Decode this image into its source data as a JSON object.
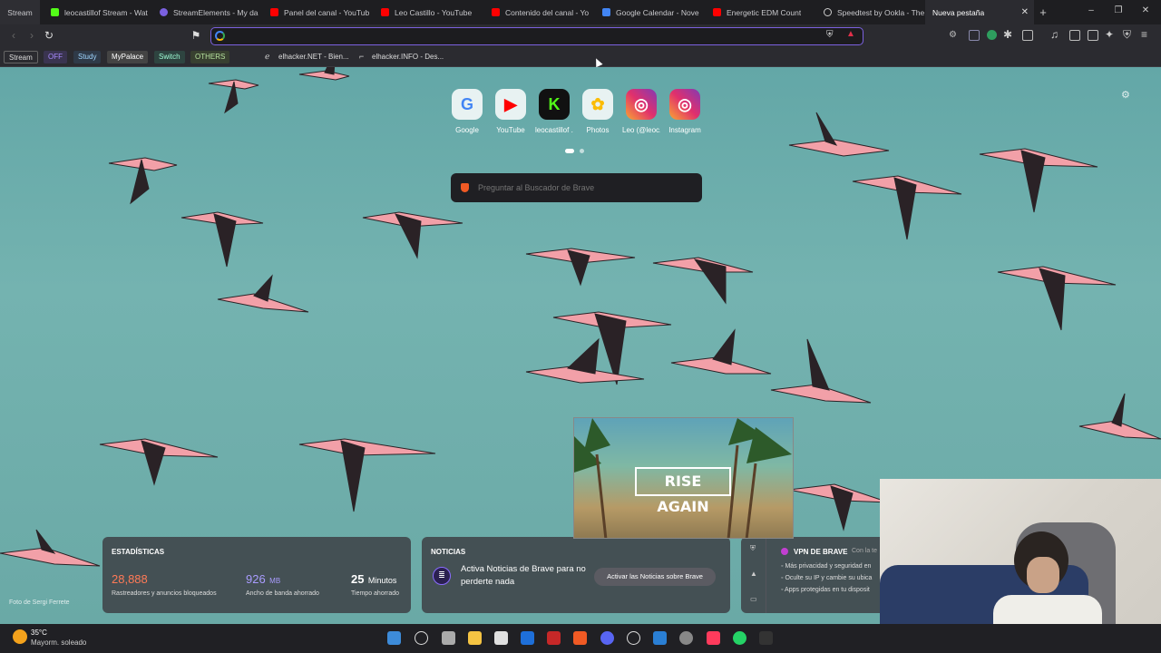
{
  "tabs": [
    {
      "title": "Stream",
      "color": "#2e2e33"
    },
    {
      "title": "leocastillof Stream - Wat",
      "color": "#53fc18"
    },
    {
      "title": "StreamElements - My da",
      "color": "#7b61e0"
    },
    {
      "title": "Panel del canal - YouTub",
      "color": "#ff0000"
    },
    {
      "title": "Leo Castillo - YouTube",
      "color": "#ff0000"
    },
    {
      "title": "Contenido del canal - Yo",
      "color": "#ff0000"
    },
    {
      "title": "Google Calendar - Nove",
      "color": "#4285f4"
    },
    {
      "title": "Energetic EDM Count",
      "color": "#ff0000"
    },
    {
      "title": "Speedtest by Ookla - The",
      "color": "#cccccc"
    },
    {
      "title": "Nueva pestaña",
      "color": "#2b2b30"
    }
  ],
  "new_tab": "+",
  "window": {
    "minimize": "–",
    "maximize": "❐",
    "close": "✕"
  },
  "address": {
    "value": "",
    "placeholder": ""
  },
  "bookmarks": [
    "Stream",
    "OFF",
    "Study",
    "MyPalace",
    "Switch",
    "OTHERS",
    "elhacker.NET - Bien...",
    "elhacker.INFO - Des..."
  ],
  "shortcuts": [
    {
      "label": "Google",
      "glyph": "G",
      "color": "#4285f4"
    },
    {
      "label": "YouTube",
      "glyph": "▶",
      "color": "#ff0000"
    },
    {
      "label": "leocastillof ...",
      "glyph": "K",
      "color": "#53fc18"
    },
    {
      "label": "Photos",
      "glyph": "✿",
      "color": "#fbbc05"
    },
    {
      "label": "Leo (@leoc...",
      "glyph": "◎",
      "color": "#e1306c"
    },
    {
      "label": "Instagram",
      "glyph": "◎",
      "color": "#e1306c"
    }
  ],
  "search": {
    "placeholder": "Preguntar al Buscador de Brave"
  },
  "stats": {
    "title": "ESTADÍSTICAS",
    "trackers": {
      "value": "28,888",
      "label": "Rastreadores y anuncios bloqueados"
    },
    "bandwidth": {
      "value": "926",
      "unit": "MB",
      "label": "Ancho de banda ahorrado"
    },
    "time": {
      "value": "25",
      "unit": "Minutos",
      "label": "Tiempo ahorrado"
    }
  },
  "news": {
    "title": "NOTICIAS",
    "text": "Activa Noticias de Brave para no perderte nada",
    "button": "Activar las Noticias sobre Brave"
  },
  "vpn": {
    "title": "VPN DE BRAVE",
    "subtitle": "Con la te",
    "items": [
      "Más privacidad y seguridad en",
      "Oculte su IP y cambie su ubica",
      "Apps protegidas en tu disposit"
    ]
  },
  "video": {
    "text": "RISE AGAIN"
  },
  "photo_credit": "Foto de Sergi Ferrete",
  "weather": {
    "temp": "35°C",
    "desc": "Mayorm. soleado"
  }
}
